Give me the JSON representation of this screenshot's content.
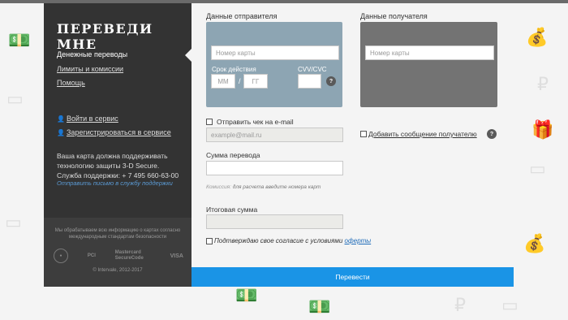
{
  "brand": {
    "title": "ПЕРЕВЕДИ МНЕ"
  },
  "sidebar": {
    "nav": [
      {
        "label": "Денежные переводы"
      },
      {
        "label": "Лимиты и комиссии"
      },
      {
        "label": "Помощь"
      }
    ],
    "login": "Войти в сервис",
    "register": "Зарегистрироваться в сервисе",
    "info_line1": "Ваша карта должна поддерживать",
    "info_line2": "технологию защиты 3-D Secure.",
    "info_line3": "Служба поддержки: + 7 495 660-63-00",
    "support_link": "Отправить письмо в службу поддержки",
    "secure_note": "Мы обрабатываем всю информацию о картах согласно международным стандартам безопасности",
    "logos": [
      "PCI",
      "Mastercard SecureCode",
      "VISA"
    ],
    "copyright": "© Intervale, 2012-2017"
  },
  "sender": {
    "title": "Данные отправителя",
    "card_placeholder": "Номер карты",
    "expiry_label": "Срок действия",
    "month_placeholder": "ММ",
    "year_placeholder": "ГГ",
    "separator": "/",
    "cvv_label": "CVV/CVC",
    "help": "?"
  },
  "recipient": {
    "title": "Данные получателя",
    "card_placeholder": "Номер карты"
  },
  "email": {
    "label": "Отправить чек на e-mail",
    "placeholder": "example@mail.ru"
  },
  "message": {
    "label": "Добавить сообщение получателю",
    "help": "?"
  },
  "amount": {
    "label": "Сумма перевода",
    "value": ""
  },
  "commission": {
    "label": "Комиссия:",
    "text": "для расчета введите номера карт"
  },
  "total": {
    "label": "Итоговая сумма",
    "value": ""
  },
  "agreement": {
    "text": "Подтверждаю свое согласие с условиями",
    "link": "оферты"
  },
  "submit": {
    "label": "Перевести"
  },
  "colors": {
    "sender_card": "#8da5b3",
    "recipient_card": "#737373",
    "accent": "#1a94e6",
    "sidebar": "#333333"
  }
}
